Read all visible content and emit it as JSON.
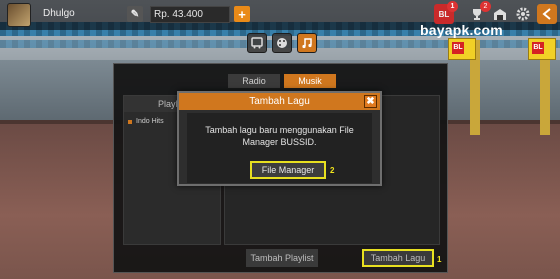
{
  "topbar": {
    "username": "Dhulgo",
    "money": "Rp. 43.400",
    "add_symbol": "+",
    "edit_symbol": "✎",
    "icons": [
      {
        "name": "bl-icon",
        "badge": "1"
      },
      {
        "name": "trophy-icon",
        "badge": "2"
      },
      {
        "name": "garage-icon",
        "badge": ""
      },
      {
        "name": "gear-icon",
        "badge": ""
      },
      {
        "name": "back-icon",
        "badge": ""
      }
    ]
  },
  "watermark": "bayapk.com",
  "signs": [
    "BL",
    "BL"
  ],
  "modes": [
    "bus-icon",
    "palette-icon",
    "music-icon"
  ],
  "panel": {
    "tabs": [
      "Radio",
      "Musik"
    ],
    "active_tab": "Musik",
    "sidebar_header": "Playl",
    "playlists": [
      "Indo Hits"
    ],
    "btn_playlist": "Tambah Playlist",
    "btn_tambah_lagu": "Tambah Lagu"
  },
  "modal": {
    "title": "Tambah Lagu",
    "close": "✖",
    "line1": "Tambah lagu baru menggunakan File",
    "line2": "Manager BUSSID.",
    "button": "File Manager"
  },
  "steps": {
    "step1": "1",
    "step2": "2"
  },
  "colors": {
    "accent": "#d0771e",
    "highlight": "#e8e020",
    "badge": "#d33333"
  }
}
